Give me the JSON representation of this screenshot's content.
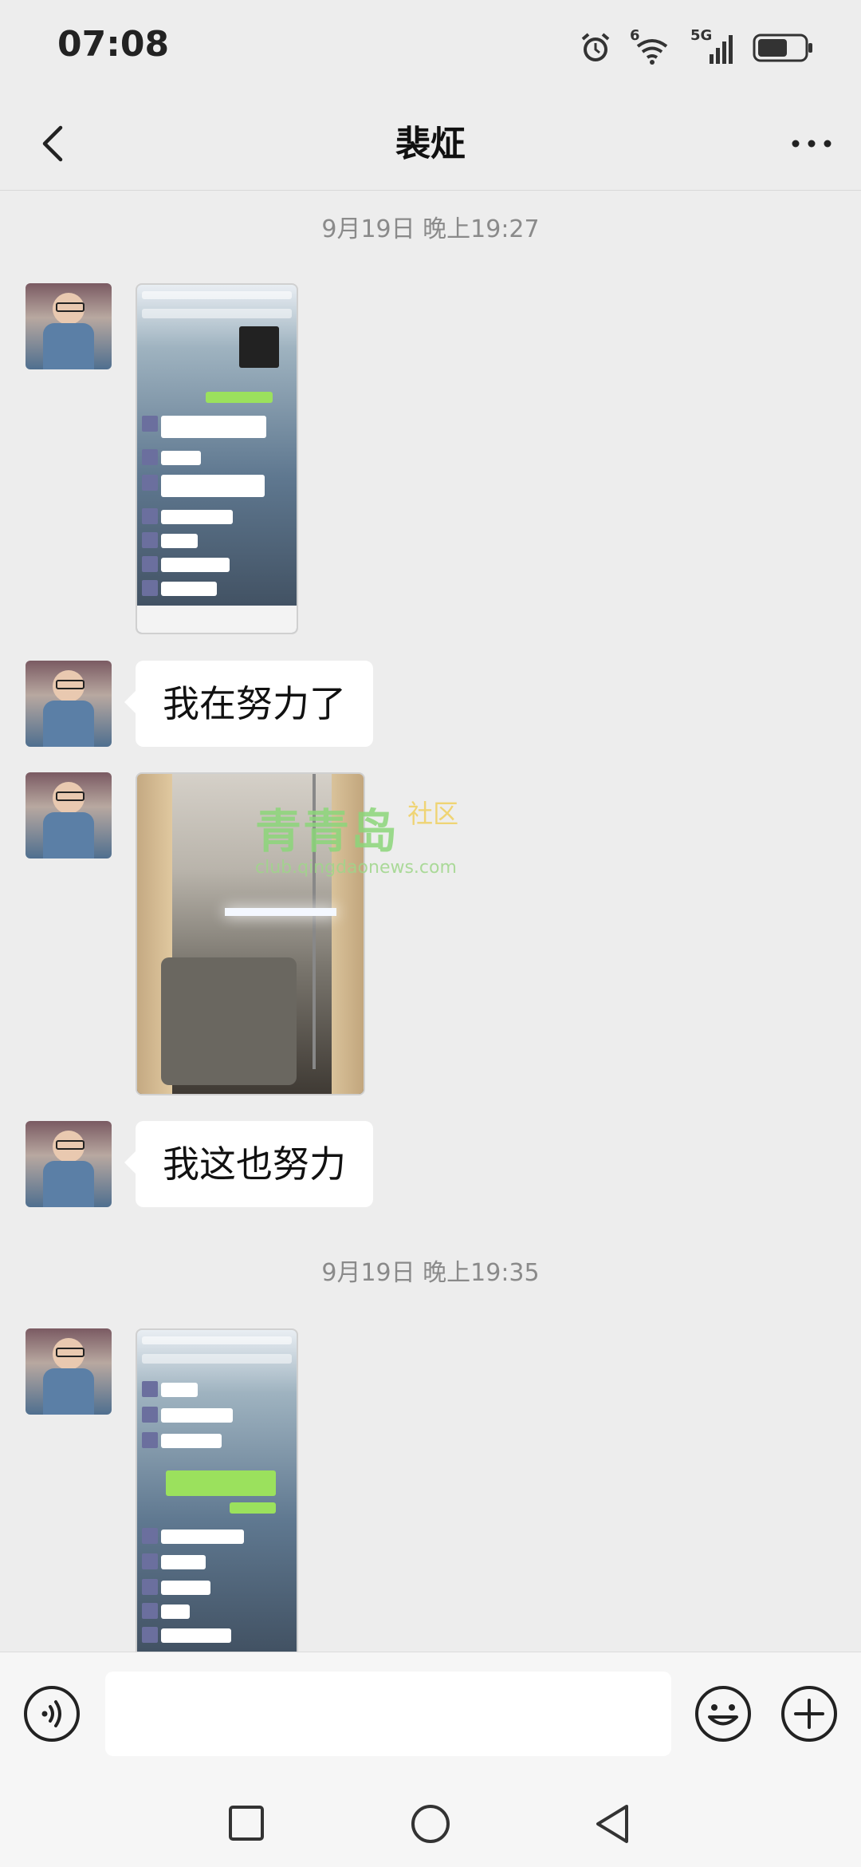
{
  "status_bar": {
    "time": "07:08",
    "wifi_label": "6",
    "network_label": "5G",
    "icons": [
      "alarm-icon",
      "wifi-icon",
      "signal-icon",
      "battery-icon"
    ]
  },
  "header": {
    "title": "裴炡",
    "back_icon": "chevron-left-icon",
    "more_icon": "more-icon"
  },
  "messages": {
    "timestamp_1": "9月19日 晚上19:27",
    "text_1": "我在努力了",
    "text_2": "我这也努力",
    "timestamp_2": "9月19日 晚上19:35"
  },
  "watermark": {
    "name": "青青岛",
    "suffix": "社区",
    "url": "club.qingdaonews.com"
  },
  "input_bar": {
    "placeholder": "",
    "icons": [
      "voice-icon",
      "emoji-icon",
      "plus-icon"
    ]
  },
  "system_nav": {
    "icons": [
      "recents-square-icon",
      "home-circle-icon",
      "back-triangle-icon"
    ]
  },
  "colors": {
    "background": "#ededed",
    "bubble": "#ffffff",
    "accent_green": "#95ec69"
  }
}
